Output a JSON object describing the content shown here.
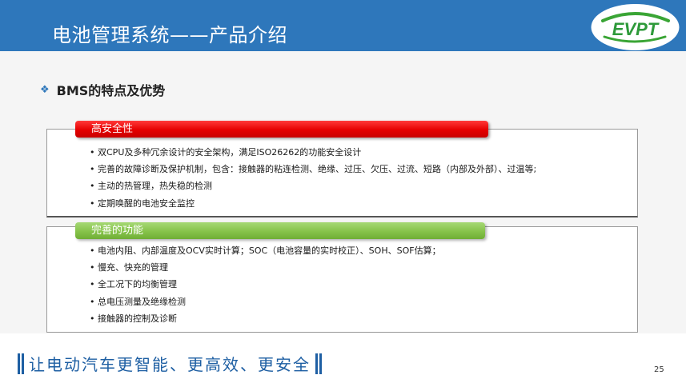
{
  "header": {
    "title": "电池管理系统——产品介绍",
    "logo_text": "EVPT",
    "background_color": "#2e77bb"
  },
  "section": {
    "bullet_icon": "diamond-bullet-icon",
    "heading": "BMS的特点及优势"
  },
  "features": {
    "label": "高安全性",
    "color": "#e50000",
    "items": [
      "双CPU及多种冗余设计的安全架构，满足ISO26262的功能安全设计",
      "完善的故障诊断及保护机制，包含：接触器的粘连检测、绝缘、过压、欠压、过流、短路（内部及外部）、过温等;",
      "主动的热管理，热失稳的检测",
      "定期唤醒的电池安全监控"
    ]
  },
  "functions": {
    "label": "完善的功能",
    "color": "#86c34a",
    "items": [
      "电池内阻、内部温度及OCV实时计算；SOC（电池容量的实时校正）、SOH、SOF估算；",
      "慢充、快充的管理",
      "全工况下的均衡管理",
      "总电压测量及绝缘检测",
      "接触器的控制及诊断"
    ]
  },
  "footer": {
    "slogan": "让电动汽车更智能、更高效、更安全",
    "page_number": "25",
    "accent_color": "#1e5fa3"
  }
}
